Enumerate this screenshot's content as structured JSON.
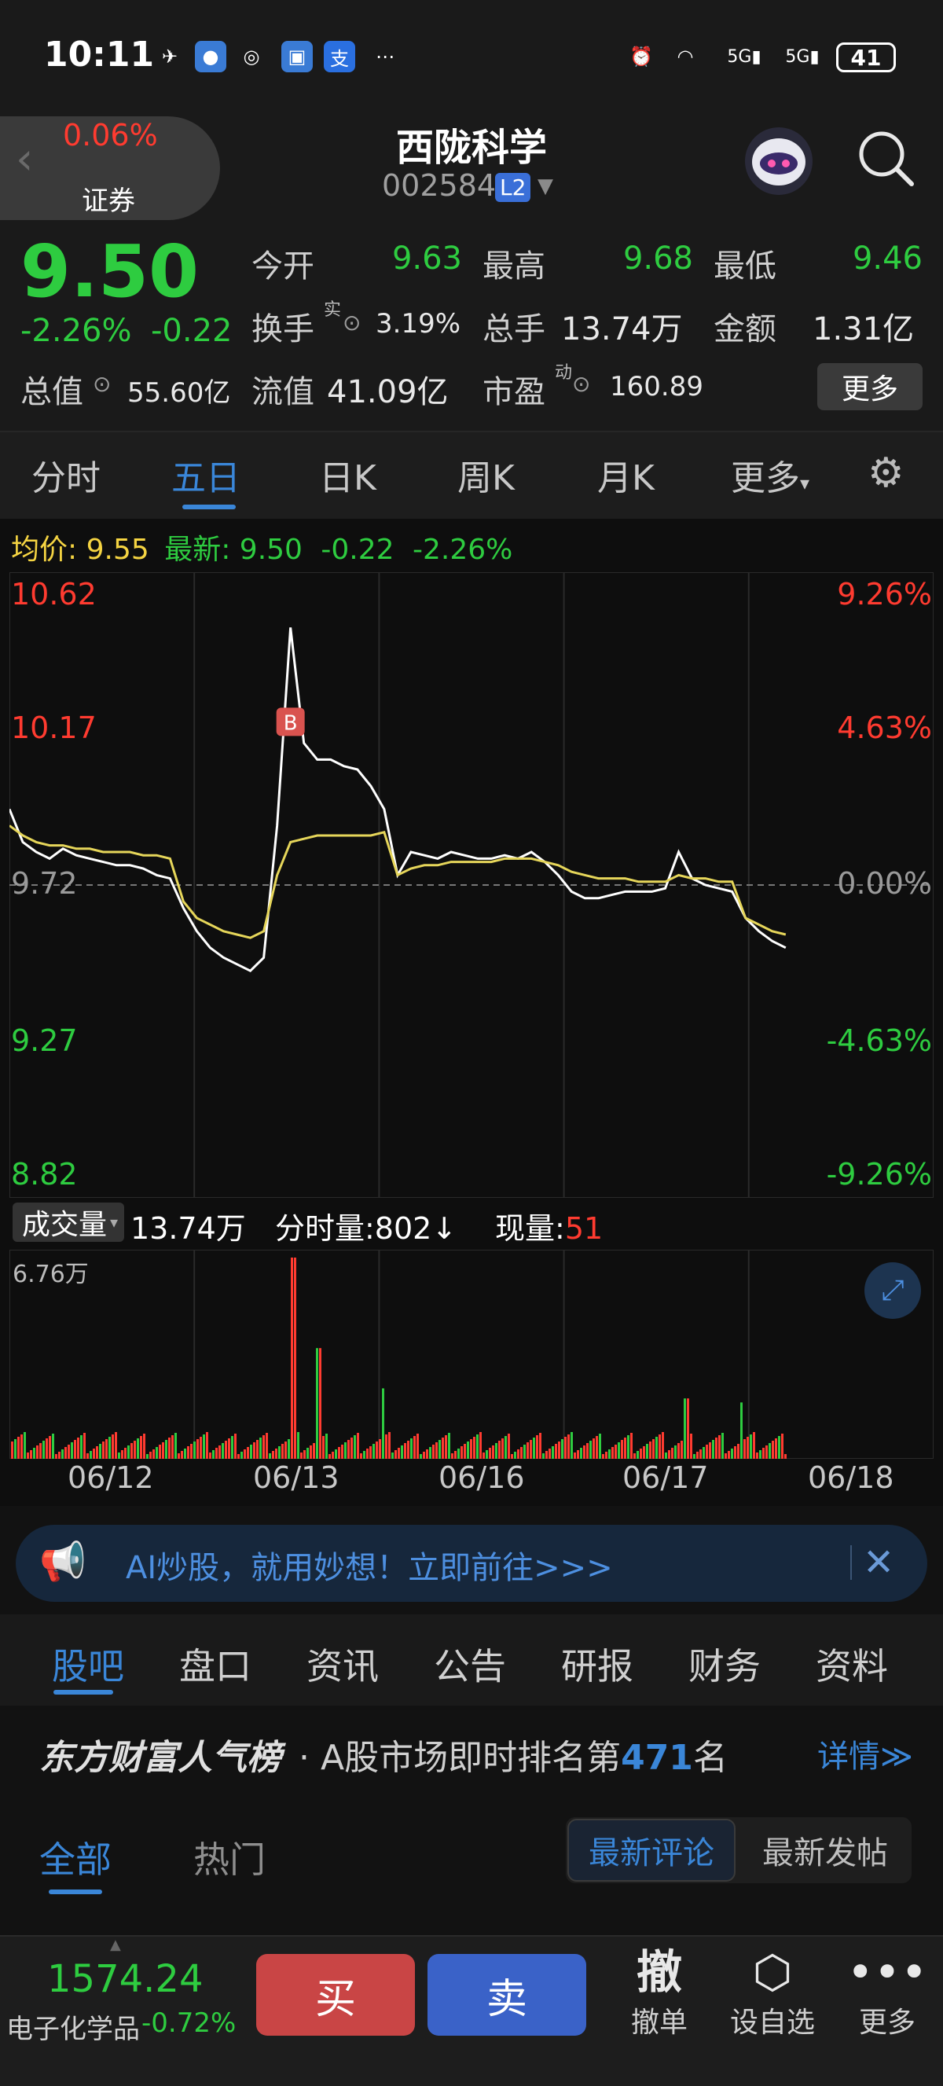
{
  "status": {
    "time": "10:11",
    "battery": "41",
    "icons": [
      "signal-app-icon",
      "chat-app-icon",
      "wechat-icon",
      "app-icon",
      "alipay-icon",
      "more-dots-icon",
      "alarm-icon",
      "wifi-icon",
      "5g-signal-icon",
      "5g-signal-icon",
      "battery-icon"
    ]
  },
  "header": {
    "back_change": "0.06%",
    "back_label": "证券",
    "stock_name": "西陇科学",
    "stock_code": "002584",
    "badge": "L2"
  },
  "quote": {
    "price": "9.50",
    "change_pct": "-2.26%",
    "change_abs": "-0.22",
    "open_label": "今开",
    "open": "9.63",
    "high_label": "最高",
    "high": "9.68",
    "low_label": "最低",
    "low": "9.46",
    "turnover_label": "换手",
    "turnover_sup": "实",
    "turnover": "3.19%",
    "volume_label": "总手",
    "volume": "13.74万",
    "amount_label": "金额",
    "amount": "1.31亿",
    "mktcap_label": "总值",
    "mktcap": "55.60亿",
    "float_label": "流值",
    "float": "41.09亿",
    "pe_label": "市盈",
    "pe_sup": "动",
    "pe": "160.89",
    "more": "更多"
  },
  "tabs": [
    "分时",
    "五日",
    "日K",
    "周K",
    "月K",
    "更多"
  ],
  "avg": {
    "avg_label": "均价:",
    "avg_value": "9.55",
    "latest_label": "最新:",
    "latest_value": "9.50",
    "chg": "-0.22",
    "pct": "-2.26%"
  },
  "chart_data": {
    "type": "line",
    "title": "",
    "xlabel": "",
    "ylabel": "",
    "x_dates": [
      "06/12",
      "06/13",
      "06/16",
      "06/17",
      "06/18"
    ],
    "y_ticks_left": [
      "10.62",
      "10.17",
      "9.72",
      "9.27",
      "8.82"
    ],
    "y_ticks_right": [
      "9.26%",
      "4.63%",
      "0.00%",
      "-4.63%",
      "-9.26%"
    ],
    "ylim": [
      8.82,
      10.62
    ],
    "prev_close": 9.72,
    "marker_label": "B",
    "series": [
      {
        "color": "#ffffff",
        "values": [
          9.95,
          9.85,
          9.82,
          9.8,
          9.83,
          9.81,
          9.8,
          9.79,
          9.78,
          9.78,
          9.77,
          9.75,
          9.74,
          9.65,
          9.58,
          9.53,
          9.5,
          9.48,
          9.46,
          9.5,
          9.9,
          10.5,
          10.15,
          10.1,
          10.1,
          10.08,
          10.07,
          10.02,
          9.95,
          9.75,
          9.82,
          9.81,
          9.8,
          9.82,
          9.81,
          9.8,
          9.8,
          9.81,
          9.8,
          9.82,
          9.79,
          9.75,
          9.7,
          9.68,
          9.68,
          9.69,
          9.7,
          9.7,
          9.7,
          9.71,
          9.82,
          9.74,
          9.72,
          9.71,
          9.7,
          9.62,
          9.58,
          9.55,
          9.53
        ]
      },
      {
        "color": "#e6d65a",
        "values": [
          9.9,
          9.87,
          9.85,
          9.84,
          9.84,
          9.83,
          9.83,
          9.82,
          9.82,
          9.82,
          9.81,
          9.81,
          9.8,
          9.67,
          9.62,
          9.6,
          9.58,
          9.57,
          9.56,
          9.58,
          9.75,
          9.85,
          9.86,
          9.87,
          9.87,
          9.87,
          9.87,
          9.87,
          9.88,
          9.75,
          9.77,
          9.78,
          9.78,
          9.79,
          9.79,
          9.79,
          9.79,
          9.8,
          9.8,
          9.8,
          9.79,
          9.78,
          9.76,
          9.75,
          9.74,
          9.74,
          9.74,
          9.73,
          9.73,
          9.73,
          9.75,
          9.74,
          9.74,
          9.73,
          9.73,
          9.62,
          9.6,
          9.58,
          9.57
        ]
      }
    ],
    "volume": {
      "label": "成交量",
      "total": "13.74万",
      "per_min": "分时量:802↓",
      "current_label": "现量:",
      "current": "51",
      "max_label": "6.76万"
    }
  },
  "ad": {
    "text": "AI炒股，就用妙想！立即前往>>>"
  },
  "lower_tabs": [
    "股吧",
    "盘口",
    "资讯",
    "公告",
    "研报",
    "财务",
    "资料"
  ],
  "rank": {
    "brand": "东方财富人气榜",
    "prefix": "· A股市场即时排名第",
    "num": "471",
    "suffix": "名",
    "detail": "详情≫"
  },
  "filter": {
    "all": "全部",
    "hot": "热门",
    "seg_a": "最新评论",
    "seg_b": "最新发帖"
  },
  "bottom": {
    "index_value": "1574.24",
    "index_name": "电子化学品",
    "index_chg": "-0.72%",
    "buy": "买",
    "sell": "卖",
    "cancel_icon": "撤",
    "cancel": "撤单",
    "watch": "设自选",
    "more": "更多"
  }
}
